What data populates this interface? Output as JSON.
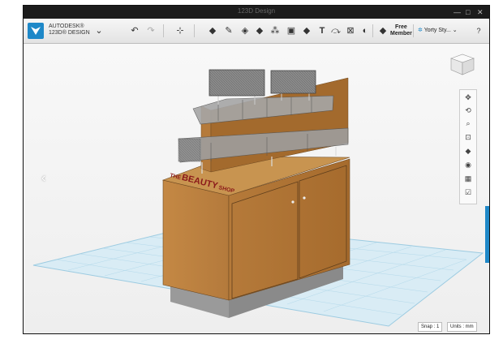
{
  "window": {
    "title": "123D Design"
  },
  "brand": {
    "line1": "AUTODESK®",
    "line2": "123D® DESIGN"
  },
  "account": {
    "line1": "Free",
    "line2": "Member"
  },
  "project": {
    "name": "Yorty Sty..."
  },
  "help": {
    "label": "?"
  },
  "sign": {
    "the": "THE",
    "beauty": "BEAUTY",
    "shop": "SHOP"
  },
  "status": {
    "snap": "Snap : 1",
    "units": "Units : mm"
  },
  "icons": {
    "toolbar": [
      "undo-icon",
      "redo-icon",
      "transform-icon",
      "primitives-icon",
      "sketch-icon",
      "construct-icon",
      "modify-icon",
      "pattern-icon",
      "group-icon",
      "text-icon",
      "snap-icon",
      "measure-icon",
      "material-icon"
    ],
    "navigation": [
      "pan-icon",
      "orbit-icon",
      "zoom-icon",
      "fit-icon",
      "view-mode-icon",
      "visibility-icon",
      "grid-icon",
      "material-view-icon"
    ]
  },
  "colors": {
    "accent": "#1e88c8",
    "grid": "#a7d2e6",
    "wood": "#b37a3c"
  }
}
